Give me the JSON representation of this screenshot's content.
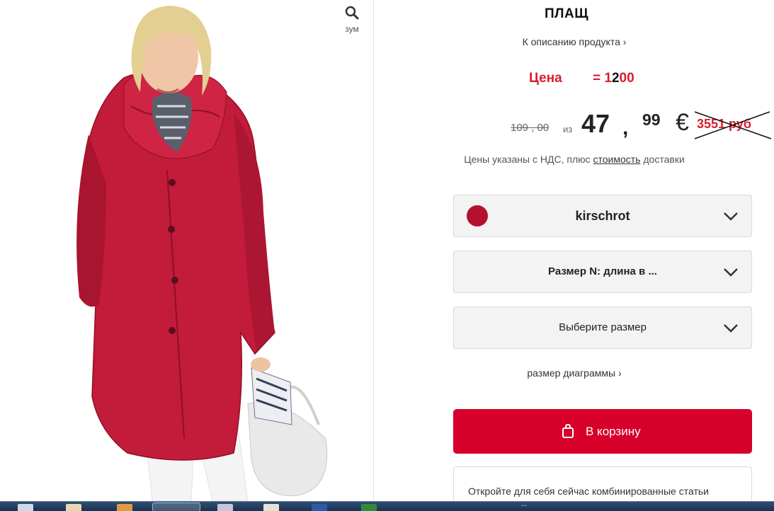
{
  "image_panel": {
    "zoom_label": "зум",
    "product_image_alt": ""
  },
  "product": {
    "title": "ПЛАЩ",
    "description_link": "К описанию продукта ›",
    "promo_label": "Цена",
    "promo_eq": "=",
    "promo_prefix": "1",
    "promo_mid": "2",
    "promo_suffix": "00",
    "old_price": "109 , 00",
    "from_word": "из",
    "price_int": "47",
    "price_comma": ",",
    "price_cents": "99",
    "currency": "€",
    "rub_price": "3551 руб",
    "vat_prefix": "Цены указаны с НДС, плюс ",
    "vat_link": "стоимость",
    "vat_suffix": " доставки"
  },
  "selectors": {
    "color_value": "kirschrot",
    "color_swatch": "#b3112e",
    "length_value": "Размер N: длина в ...",
    "size_value": "Выберите размер"
  },
  "size_chart_link": "размер диаграммы ›",
  "cart_button": {
    "label": "В корзину",
    "color": "#d6002a"
  },
  "combo": {
    "text": "Откройте для себя сейчас комбинированные статьи"
  },
  "taskbar": {
    "dots": "..."
  }
}
